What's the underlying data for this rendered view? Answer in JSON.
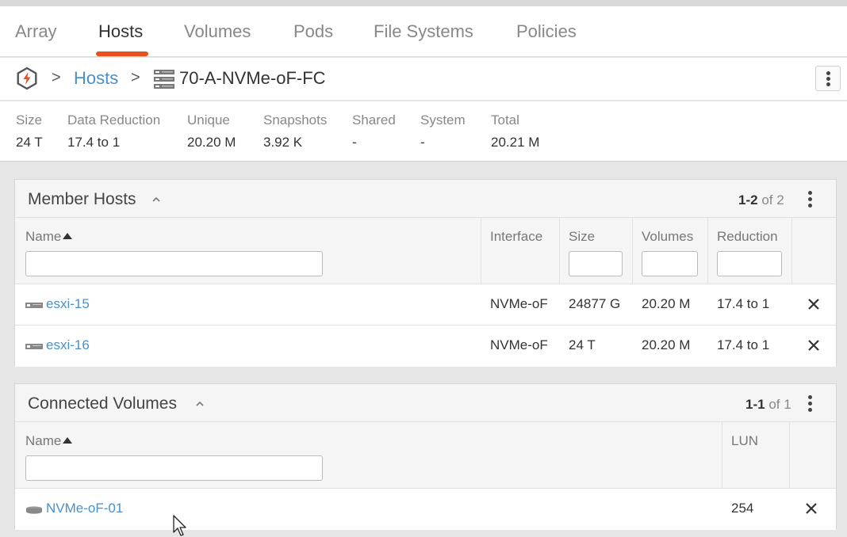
{
  "nav": {
    "tabs": [
      {
        "label": "Array"
      },
      {
        "label": "Hosts"
      },
      {
        "label": "Volumes"
      },
      {
        "label": "Pods"
      },
      {
        "label": "File Systems"
      },
      {
        "label": "Policies"
      }
    ],
    "active": "Hosts",
    "accent": "#e8501d"
  },
  "breadcrumb": {
    "sep1": ">",
    "link": "Hosts",
    "sep2": ">",
    "current": "70-A-NVMe-oF-FC"
  },
  "stats": [
    {
      "label": "Size",
      "value": "24 T"
    },
    {
      "label": "Data Reduction",
      "value": "17.4 to 1"
    },
    {
      "label": "Unique",
      "value": "20.20 M"
    },
    {
      "label": "Snapshots",
      "value": "3.92 K"
    },
    {
      "label": "Shared",
      "value": "-"
    },
    {
      "label": "System",
      "value": "-"
    },
    {
      "label": "Total",
      "value": "20.21 M"
    }
  ],
  "member_hosts": {
    "title": "Member Hosts",
    "range": "1-2",
    "of": "of 2",
    "columns": {
      "name": "Name",
      "interface": "Interface",
      "size": "Size",
      "volumes": "Volumes",
      "reduction": "Reduction"
    },
    "rows": [
      {
        "name": "esxi-15",
        "interface": "NVMe-oF",
        "size": "24877 G",
        "volumes": "20.20 M",
        "reduction": "17.4 to 1"
      },
      {
        "name": "esxi-16",
        "interface": "NVMe-oF",
        "size": "24 T",
        "volumes": "20.20 M",
        "reduction": "17.4 to 1"
      }
    ]
  },
  "connected_volumes": {
    "title": "Connected Volumes",
    "range": "1-1",
    "of": "of 1",
    "columns": {
      "name": "Name",
      "lun": "LUN"
    },
    "rows": [
      {
        "name": "NVMe-oF-01",
        "lun": "254"
      }
    ]
  },
  "colors": {
    "link": "#4a90c9",
    "text": "#333333",
    "muted": "#888888"
  }
}
